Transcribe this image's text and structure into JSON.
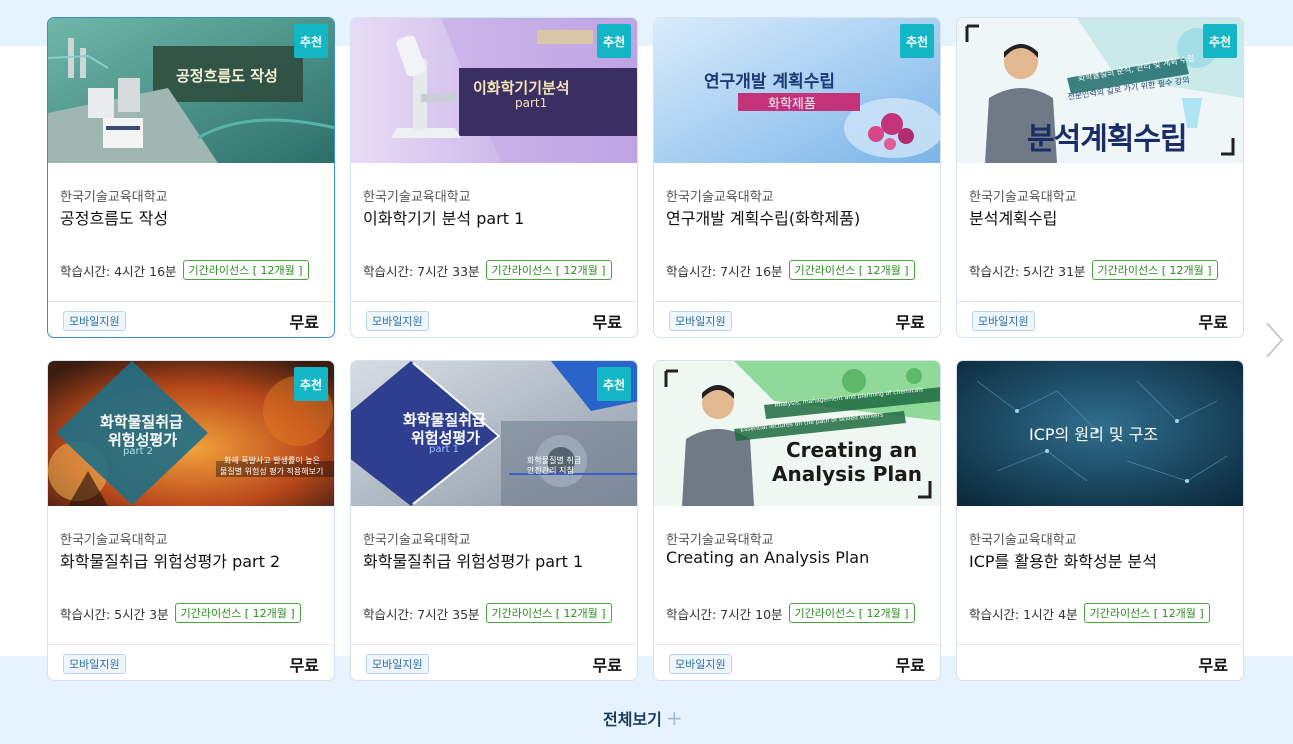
{
  "courses": [
    {
      "badge": "추천",
      "thumb_text": "공정흐름도 작성",
      "org": "한국기술교육대학교",
      "title": "공정흐름도 작성",
      "time": "학습시간: 4시간 16분",
      "license": "기간라이선스 [ 12개월 ]",
      "mobile": "모바일지원",
      "price": "무료"
    },
    {
      "badge": "추천",
      "thumb_text": "이화학기기분석",
      "thumb_sub": "part1",
      "org": "한국기술교육대학교",
      "title": "이화학기기 분석 part 1",
      "time": "학습시간: 7시간 33분",
      "license": "기간라이선스 [ 12개월 ]",
      "mobile": "모바일지원",
      "price": "무료"
    },
    {
      "badge": "추천",
      "thumb_text": "연구개발 계획수립",
      "thumb_sub": "화학제품",
      "org": "한국기술교육대학교",
      "title": "연구개발 계획수립(화학제품)",
      "time": "학습시간: 7시간 16분",
      "license": "기간라이선스 [ 12개월 ]",
      "mobile": "모바일지원",
      "price": "무료"
    },
    {
      "badge": "추천",
      "thumb_text": "분석계획수립",
      "thumb_sub": "화학물질의 분석, 관리 및 계획 수립",
      "thumb_sub2": "전문인력의 길로 가기 위한 필수 강의",
      "org": "한국기술교육대학교",
      "title": "분석계획수립",
      "time": "학습시간: 5시간 31분",
      "license": "기간라이선스 [ 12개월 ]",
      "mobile": "모바일지원",
      "price": "무료"
    },
    {
      "badge": "추천",
      "thumb_text": "화학물질취급",
      "thumb_text2": "위험성평가",
      "thumb_sub": "part 2",
      "thumb_sub2": "화재 폭발사고 발생률이 높은",
      "thumb_sub3": "물질별 위험성 평가 적용해보기",
      "org": "한국기술교육대학교",
      "title": "화학물질취급 위험성평가 part 2",
      "time": "학습시간: 5시간 3분",
      "license": "기간라이선스 [ 12개월 ]",
      "mobile": "모바일지원",
      "price": "무료"
    },
    {
      "badge": "추천",
      "thumb_text": "화학물질취급",
      "thumb_text2": "위험성평가",
      "thumb_sub": "part 1",
      "thumb_sub2": "화학물질별 취급",
      "thumb_sub3": "안전관리 지침",
      "org": "한국기술교육대학교",
      "title": "화학물질취급 위험성평가 part 1",
      "time": "학습시간: 7시간 35분",
      "license": "기간라이선스 [ 12개월 ]",
      "mobile": "모바일지원",
      "price": "무료"
    },
    {
      "badge": "",
      "thumb_text": "Creating an",
      "thumb_text2": "Analysis Plan",
      "thumb_sub": "Analysis, management and planning of chemicals",
      "thumb_sub2": "Essential lectures on the path of skilled workers",
      "org": "한국기술교육대학교",
      "title": "Creating an Analysis Plan",
      "time": "학습시간: 7시간 10분",
      "license": "기간라이선스 [ 12개월 ]",
      "mobile": "모바일지원",
      "price": "무료"
    },
    {
      "badge": "",
      "thumb_text": "ICP의 원리 및 구조",
      "org": "한국기술교육대학교",
      "title": "ICP를 활용한 화학성분 분석",
      "time": "학습시간: 1시간 4분",
      "license": "기간라이선스 [ 12개월 ]",
      "mobile": "",
      "price": "무료"
    }
  ],
  "view_all_label": "전체보기",
  "view_all_plus": "+",
  "colors": {
    "badge": "#13b6c4",
    "license_green": "#2d8a22",
    "mobile_blue": "#2e6f9e",
    "light_bg": "#e4f3fc"
  },
  "icons": {
    "next": "chevron-right-icon",
    "plus": "plus-icon"
  }
}
